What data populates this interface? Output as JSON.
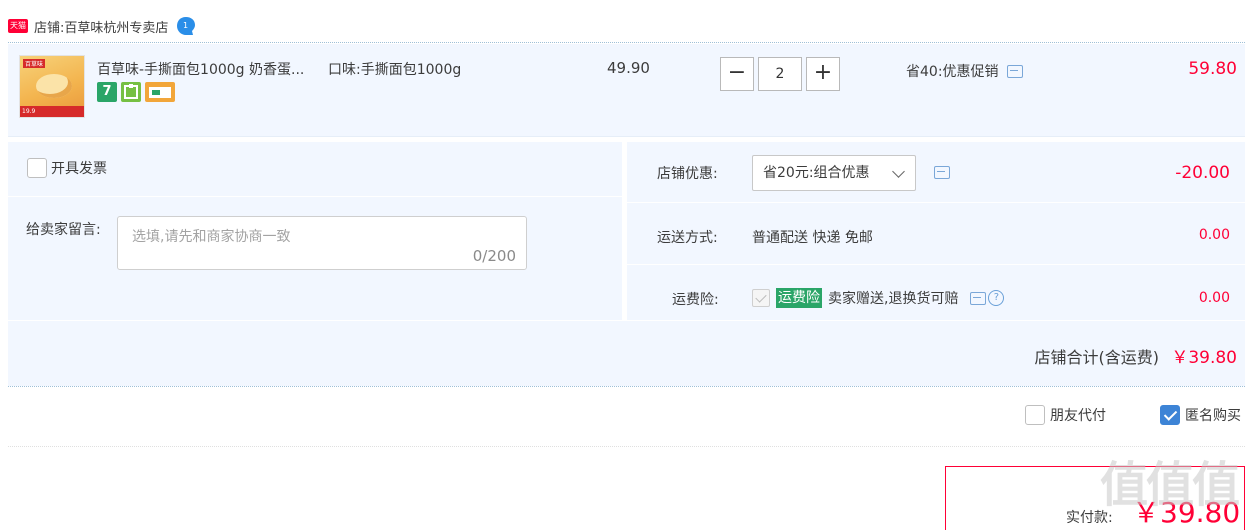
{
  "shop": {
    "badge": "天猫",
    "label": "店铺:",
    "name": "百草味杭州专卖店"
  },
  "item": {
    "title": "百草味-手撕面包1000g 奶香蛋...",
    "sku": "口味:手撕面包1000g",
    "unit_price": "49.90",
    "quantity": "2",
    "minus": "−",
    "plus": "+",
    "promo": "省40:优惠促销",
    "total": "59.80",
    "service_icons": [
      "7",
      "guarantee-icon",
      "card-icon"
    ],
    "thumb_tag": "百草味",
    "thumb_price": "19.9"
  },
  "invoice": {
    "label": "开具发票"
  },
  "message": {
    "label": "给卖家留言:",
    "placeholder": "选填,请先和商家协商一致",
    "count": "0/200"
  },
  "coupon": {
    "label": "店铺优惠:",
    "selected": "省20元:组合优惠",
    "amount": "-20.00"
  },
  "shipping": {
    "label": "运送方式:",
    "value": "普通配送 快递 免邮",
    "amount": "0.00"
  },
  "insurance": {
    "label": "运费险:",
    "badge": "运费险",
    "text": "卖家赠送,退换货可赔",
    "amount": "0.00"
  },
  "shop_total": {
    "label": "店铺合计(含运费)",
    "value": "￥39.80"
  },
  "options": {
    "friend_pay": "朋友代付",
    "anonymous": "匿名购买"
  },
  "payment": {
    "label": "实付款:",
    "value": "￥39.80"
  },
  "watermark": "值值值",
  "colors": {
    "price_red": "#ff0036",
    "panel_bg": "#f2f7ff",
    "check_blue": "#3d84d6",
    "green": "#2aa568"
  }
}
